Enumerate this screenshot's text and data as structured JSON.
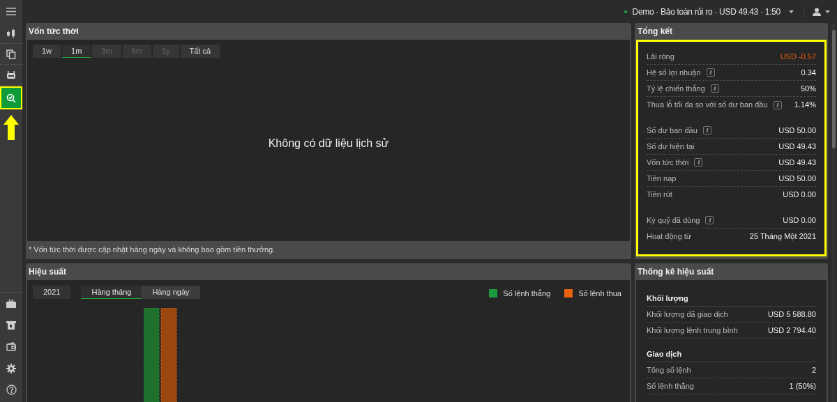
{
  "sidebar": {
    "top_items": [
      {
        "selected": false
      },
      {
        "selected": false
      },
      {
        "selected": false
      },
      {
        "selected": true
      }
    ]
  },
  "top_bar": {
    "account": "Demo · Bảo toàn rủi ro · USD 49.43 · 1:50"
  },
  "equity_panel": {
    "title": "Vốn tức thời",
    "ranges": [
      {
        "label": "1w",
        "selected": false,
        "disabled": false
      },
      {
        "label": "1m",
        "selected": true,
        "disabled": false
      },
      {
        "label": "3m",
        "selected": false,
        "disabled": true
      },
      {
        "label": "6m",
        "selected": false,
        "disabled": true
      },
      {
        "label": "1y",
        "selected": false,
        "disabled": true
      },
      {
        "label": "Tất cả",
        "selected": false,
        "disabled": false
      }
    ],
    "empty_message": "Không có dữ liệu lịch sử",
    "footnote": "* Vốn tức thời được cập nhật hàng ngày và không bao gồm tiền thưởng."
  },
  "performance_panel": {
    "title": "Hiệu suất",
    "year": "2021",
    "periods": [
      {
        "label": "Hàng tháng",
        "selected": true
      },
      {
        "label": "Hàng ngày",
        "selected": false
      }
    ],
    "legend": [
      {
        "label": "Số lệnh thắng",
        "color": "#1a9a3a"
      },
      {
        "label": "Số lệnh thua",
        "color": "#e8620f"
      }
    ]
  },
  "summary_panel": {
    "title": "Tổng kết",
    "groups": [
      [
        {
          "label": "Lãi ròng",
          "value": "USD -0.57",
          "info": false,
          "negative": true
        },
        {
          "label": "Hệ số lợi nhuận",
          "value": "0.34",
          "info": true,
          "negative": false
        },
        {
          "label": "Tỷ lệ chiến thắng",
          "value": "50%",
          "info": true,
          "negative": false
        },
        {
          "label": "Thua lỗ tối đa so với số dư ban đầu",
          "value": "1.14%",
          "info": true,
          "negative": false
        }
      ],
      [
        {
          "label": "Số dư ban đầu",
          "value": "USD 50.00",
          "info": true,
          "negative": false
        },
        {
          "label": "Số dư hiện tại",
          "value": "USD 49.43",
          "info": false,
          "negative": false
        },
        {
          "label": "Vốn tức thời",
          "value": "USD 49.43",
          "info": true,
          "negative": false
        },
        {
          "label": "Tiền nạp",
          "value": "USD 50.00",
          "info": false,
          "negative": false
        },
        {
          "label": "Tiền rút",
          "value": "USD 0.00",
          "info": false,
          "negative": false
        }
      ],
      [
        {
          "label": "Ký quỹ đã dùng",
          "value": "USD 0.00",
          "info": true,
          "negative": false
        },
        {
          "label": "Hoạt động từ",
          "value": "25 Tháng Một 2021",
          "info": false,
          "negative": false
        }
      ]
    ]
  },
  "stats_panel": {
    "title": "Thống kê hiệu suất",
    "sections": [
      {
        "heading": "Khối lượng",
        "rows": [
          {
            "label": "Khối lượng đã giao dịch",
            "value": "USD 5 588.80"
          },
          {
            "label": "Khối lượng lệnh trung bình",
            "value": "USD 2 794.40"
          }
        ]
      },
      {
        "heading": "Giao dịch",
        "rows": [
          {
            "label": "Tổng số lệnh",
            "value": "2"
          },
          {
            "label": "Số lệnh thắng",
            "value": "1 (50%)"
          }
        ]
      }
    ]
  }
}
